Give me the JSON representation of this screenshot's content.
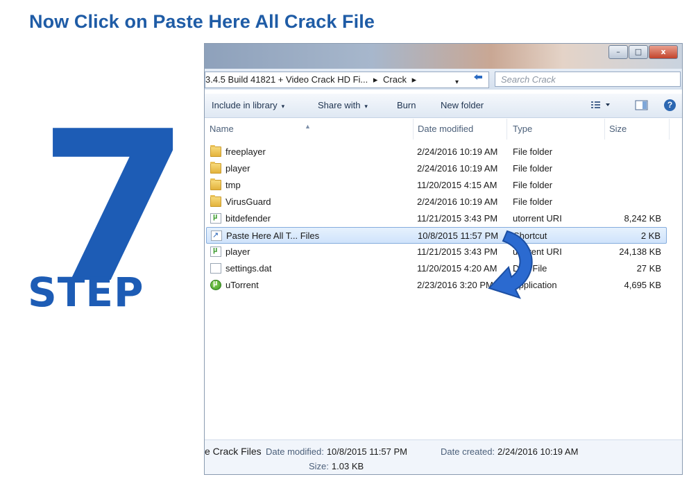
{
  "heading": "Now Click on Paste Here All Crack File",
  "step": {
    "number": "7",
    "word": "STEP"
  },
  "window": {
    "controls": {
      "minimize": "–",
      "maximize": "□",
      "close": "x"
    },
    "address": {
      "segments": [
        "3.4.5 Build 41821 + Video Crack HD Fi...",
        "▸",
        "Crack",
        "▸"
      ],
      "dropdown": "▾"
    },
    "search": {
      "placeholder": "Search Crack"
    },
    "toolbar": {
      "include_in_library": "Include in library",
      "share_with": "Share with",
      "burn": "Burn",
      "new_folder": "New folder",
      "caret": "▾"
    },
    "columns": {
      "name": "Name",
      "date": "Date modified",
      "type": "Type",
      "size": "Size"
    },
    "files": [
      {
        "name": "freeplayer",
        "date": "2/24/2016 10:19 AM",
        "type": "File folder",
        "size": "",
        "icon": "folder-icon"
      },
      {
        "name": "player",
        "date": "2/24/2016 10:19 AM",
        "type": "File folder",
        "size": "",
        "icon": "folder-icon"
      },
      {
        "name": "tmp",
        "date": "11/20/2015 4:15 AM",
        "type": "File folder",
        "size": "",
        "icon": "folder-icon"
      },
      {
        "name": "VirusGuard",
        "date": "2/24/2016 10:19 AM",
        "type": "File folder",
        "size": "",
        "icon": "folder-icon"
      },
      {
        "name": "bitdefender",
        "date": "11/21/2015 3:43 PM",
        "type": "utorrent URI",
        "size": "8,242 KB",
        "icon": "utorrent-uri-icon"
      },
      {
        "name": "Paste Here All T... Files",
        "date": "10/8/2015 11:57 PM",
        "type": "Shortcut",
        "size": "2 KB",
        "icon": "shortcut-icon",
        "selected": true
      },
      {
        "name": "player",
        "date": "11/21/2015 3:43 PM",
        "type": "utorrent URI",
        "size": "24,138 KB",
        "icon": "utorrent-uri-icon"
      },
      {
        "name": "settings.dat",
        "date": "11/20/2015 4:20 AM",
        "type": "DAT File",
        "size": "27 KB",
        "icon": "file-icon"
      },
      {
        "name": "uTorrent",
        "date": "2/23/2016 3:20 PM",
        "type": "Application",
        "size": "4,695 KB",
        "icon": "app-icon"
      }
    ],
    "status": {
      "name": "e Crack Files",
      "date_modified_label": "Date modified:",
      "date_modified": "10/8/2015 11:57 PM",
      "date_created_label": "Date created:",
      "date_created": "2/24/2016 10:19 AM",
      "size_label": "Size:",
      "size": "1.03 KB"
    }
  },
  "colors": {
    "accent": "#1d5cb5",
    "heading": "#1f5ca6"
  }
}
